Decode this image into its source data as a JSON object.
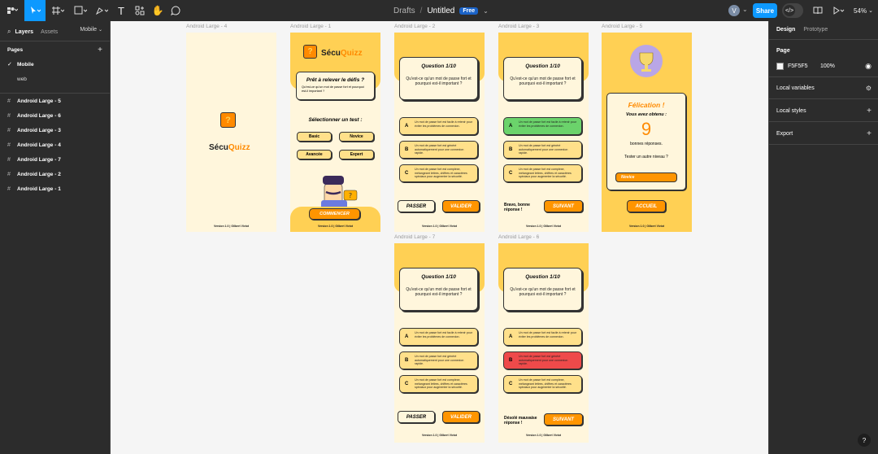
{
  "toolbar": {
    "breadcrumb_drafts": "Drafts",
    "separator": "/",
    "file_title": "Untitled",
    "plan_badge": "Free",
    "avatar_initial": "V",
    "share_label": "Share",
    "zoom": "54%",
    "icons": [
      "figma-menu-icon",
      "move-tool-icon",
      "frame-tool-icon",
      "shape-tool-icon",
      "pen-tool-icon",
      "text-tool-icon",
      "resources-icon",
      "hand-tool-icon",
      "comment-icon",
      "code-icon",
      "book-icon",
      "play-icon"
    ]
  },
  "left_panel": {
    "tabs": [
      "Layers",
      "Assets"
    ],
    "page_selector": "Mobile",
    "pages_heading": "Pages",
    "pages": [
      {
        "label": "Mobile",
        "selected": true
      },
      {
        "label": "web",
        "selected": false
      }
    ],
    "layers": [
      "Android Large - 5",
      "Android Large - 6",
      "Android Large - 3",
      "Android Large - 4",
      "Android Large - 7",
      "Android Large - 2",
      "Android Large - 1"
    ]
  },
  "right_panel": {
    "tabs": [
      "Design",
      "Prototype"
    ],
    "page_heading": "Page",
    "bg_color_hex": "F5F5F5",
    "bg_opacity": "100%",
    "sections": [
      "Local variables",
      "Local styles",
      "Export"
    ]
  },
  "canvas": {
    "frame_labels": {
      "f4": "Android Large - 4",
      "f1": "Android Large - 1",
      "f2": "Android Large - 2",
      "f3": "Android Large - 3",
      "f5": "Android Large - 5",
      "f7": "Android Large - 7",
      "f6": "Android Large - 6"
    },
    "app": {
      "logo_letter": "?",
      "name_prefix": "Sécu",
      "name_suffix": "Quizz",
      "version": "Version 1.0 | Gilbert Viviot",
      "ready_title": "Prêt à relever le défis ?",
      "ready_text": "Qu'est-ce qu'un mot de passe fort et pourquoi est-il important ?",
      "select_title": "Sélectionner un test :",
      "levels": [
        "Basic",
        "Novice",
        "Avancée",
        "Expert"
      ],
      "start_button": "COMMENCER",
      "question_title": "Question 1/10",
      "question_text": "Qu'est-ce qu'un mot de passe fort et pourquoi est-il important ?",
      "answers": [
        {
          "letter": "A",
          "text": "Un mot de passe fort est facile à retenir pour éviter les problèmes de connexion."
        },
        {
          "letter": "B",
          "text": "Un mot de passe fort est généré automatiquement pour une connexion rapide."
        },
        {
          "letter": "C",
          "text": "Un mot de passe fort est complexe, mélangeant lettres, chiffres et caractères spéciaux pour augmenter la sécurité."
        }
      ],
      "skip_button": "PASSER",
      "validate_button": "VALIDER",
      "next_button": "SUIVANT",
      "good_answer": "Bravo, bonne réponse !",
      "bad_answer": "Désolé mauvaise réponse !",
      "congrats_title": "Félication !",
      "score_label": "Vous avez obtenu :",
      "score": "9",
      "good_answers_label": "bonnes réponses.",
      "try_level_label": "Tester un autre niveau ?",
      "level_select": "Novice",
      "home_button": "ACCUEIL"
    }
  }
}
